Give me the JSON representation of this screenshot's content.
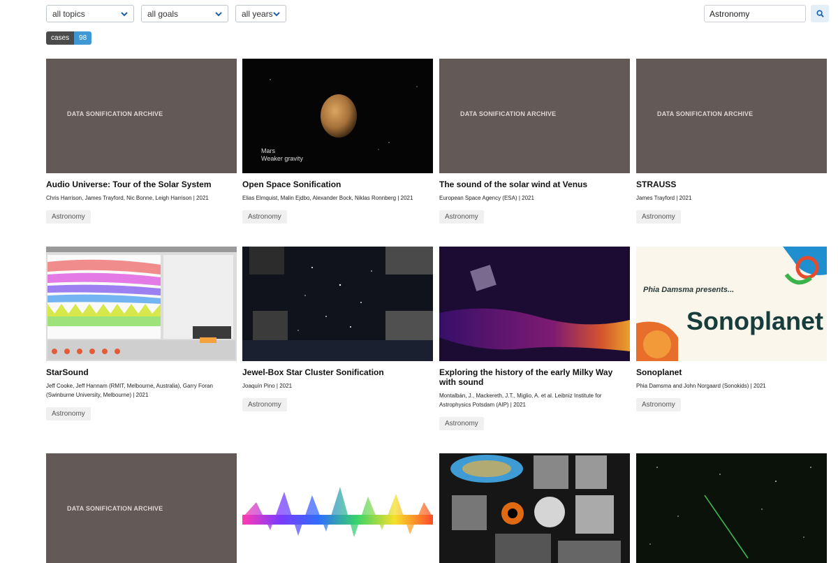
{
  "filters": {
    "topics": "all topics",
    "goals": "all goals",
    "years": "all years"
  },
  "search": {
    "value": "Astronomy",
    "icon": "search-icon"
  },
  "badge": {
    "label": "cases",
    "count": "98"
  },
  "watermark": "DATA SONIFICATION ARCHIVE",
  "cards": [
    {
      "title": "Audio Universe: Tour of the Solar System",
      "meta": "Chris Harrison, James Trayford, Nic Bonne, Leigh Harrison | 2021",
      "tag": "Astronomy"
    },
    {
      "title": "Open Space Sonification",
      "meta": "Elias Elmquist, Malin Ejdbo, Alexander Bock, Niklas Ronnberg | 2021",
      "tag": "Astronomy",
      "caption1": "Mars",
      "caption2": "Weaker gravity"
    },
    {
      "title": "The sound of the solar wind at Venus",
      "meta": "European Space Agency (ESA) | 2021",
      "tag": "Astronomy"
    },
    {
      "title": "STRAUSS",
      "meta": "James Trayford | 2021",
      "tag": "Astronomy"
    },
    {
      "title": "StarSound",
      "meta": "Jeff Cooke, Jeff Hannam (RMIT, Melbourne, Australia), Garry Foran (Swinburne University, Melbourne) | 2021",
      "tag": "Astronomy"
    },
    {
      "title": "Jewel-Box Star Cluster Sonification",
      "meta": "Joaquín Pino | 2021",
      "tag": "Astronomy"
    },
    {
      "title": "Exploring the history of the early Milky Way with sound",
      "meta": "Montalbán, J., Mackereth, J.T., Miglio, A. et al. Leibniz Institute for Astrophysics Potsdam (AIP) | 2021",
      "tag": "Astronomy"
    },
    {
      "title": "Sonoplanet",
      "meta": "Phia Damsma and John Norgaard (Sonokids) | 2021",
      "tag": "Astronomy",
      "thumb_line1": "Phia Damsma presents...",
      "thumb_line2": "Sonoplanet"
    }
  ]
}
